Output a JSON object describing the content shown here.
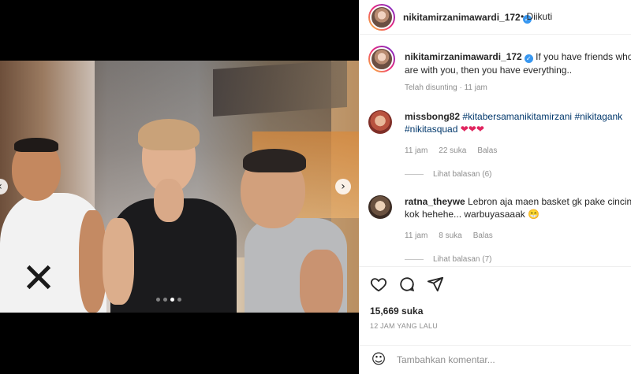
{
  "post": {
    "username": "nikitamirzanimawardi_172",
    "follow_status": "Diikuti",
    "separator": "•",
    "caption": "If you have friends who are with you, then you have everything..",
    "caption_meta": "Telah disunting · 11 jam",
    "likes": "15,669 suka",
    "time_ago": "12 JAM YANG LALU"
  },
  "media": {
    "carousel_total": 4,
    "carousel_active": 3
  },
  "comments": [
    {
      "username": "missbong82",
      "tags": [
        "#kitabersamanikitamirzani",
        "#nikitagank",
        "#nikitasquad"
      ],
      "emoji": "❤❤❤",
      "time": "11 jam",
      "likes": "22 suka",
      "reply": "Balas",
      "view_replies": "Lihat balasan (6)"
    },
    {
      "username": "ratna_theywe",
      "text": "Lebron aja maen basket gk pake cincin kok hehehe... warbuyasaaak",
      "emoji": "😁",
      "time": "11 jam",
      "likes": "8 suka",
      "reply": "Balas",
      "view_replies": "Lihat balasan (7)"
    }
  ],
  "composer": {
    "placeholder": "Tambahkan komentar..."
  },
  "icons": {
    "verified": "verified-badge-icon",
    "like": "heart-icon",
    "comment": "comment-bubble-icon",
    "share": "paper-plane-icon",
    "emoji": "smiley-icon",
    "next": "chevron-right-icon"
  },
  "colors": {
    "verified": "#3897f0",
    "hashtag": "#00376b",
    "heart": "#e0245e",
    "muted": "#8e8e8e"
  }
}
